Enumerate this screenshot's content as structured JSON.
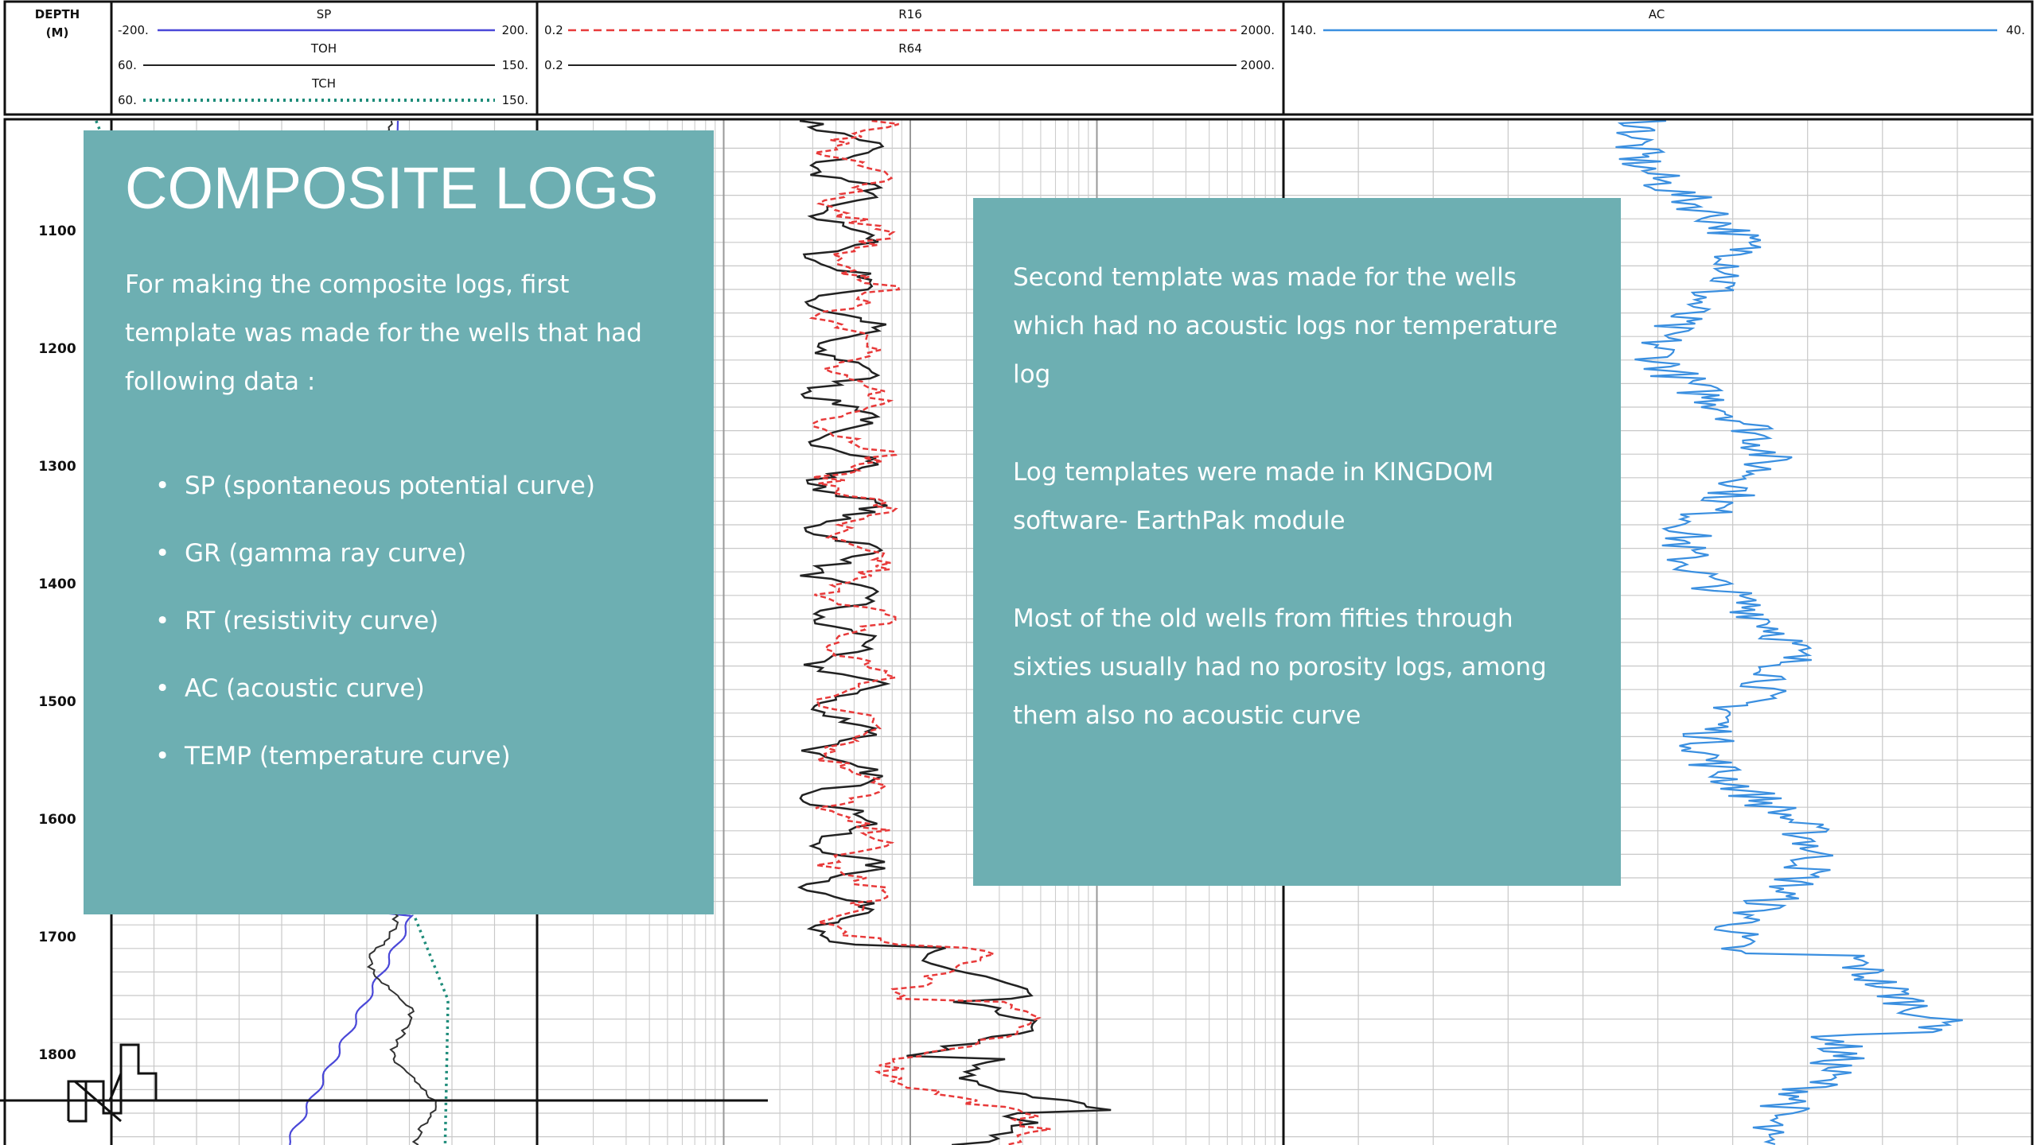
{
  "header": {
    "depth_label_1": "DEPTH",
    "depth_label_2": "(M)",
    "track1": [
      {
        "name": "SP",
        "min": "-200.",
        "max": "200.",
        "color": "#4a48d8",
        "style": "solid"
      },
      {
        "name": "TOH",
        "min": "60.",
        "max": "150.",
        "color": "#222222",
        "style": "solid"
      },
      {
        "name": "TCH",
        "min": "60.",
        "max": "150.",
        "color": "#1e8c7a",
        "style": "dotted"
      }
    ],
    "track2": [
      {
        "name": "R16",
        "min": "0.2",
        "max": "2000.",
        "color": "#e83a3a",
        "style": "dashed"
      },
      {
        "name": "R64",
        "min": "0.2",
        "max": "2000.",
        "color": "#222222",
        "style": "solid"
      }
    ],
    "track3": [
      {
        "name": "AC",
        "min": "140.",
        "max": "40.",
        "color": "#3a8fe0",
        "style": "solid"
      }
    ]
  },
  "depth_ticks": [
    "1100",
    "1200",
    "1300",
    "1400",
    "1500",
    "1600",
    "1700",
    "1800"
  ],
  "left_panel": {
    "title": "COMPOSITE LOGS",
    "intro": "For making the composite logs, first template was made for the wells that had following data :",
    "bullets": [
      "SP (spontaneous potential curve)",
      "GR (gamma ray curve)",
      "RT (resistivity curve)",
      "AC (acoustic curve)",
      "TEMP (temperature curve)"
    ],
    "bullet_glyph": "•"
  },
  "right_panel": {
    "paragraphs": [
      "Second template was made for the wells which had no acoustic logs nor temperature log",
      "Log templates were made in KINGDOM software- EarthPak module",
      "Most of the old wells from fifties through sixties usually had no porosity logs, among them also no acoustic curve"
    ]
  },
  "colors": {
    "panel": "#6dafb2",
    "grid": "#b4b4b4",
    "sp": "#4a48d8",
    "r16": "#e83a3a",
    "ac": "#3a8fe0",
    "tch": "#1e8c7a"
  }
}
